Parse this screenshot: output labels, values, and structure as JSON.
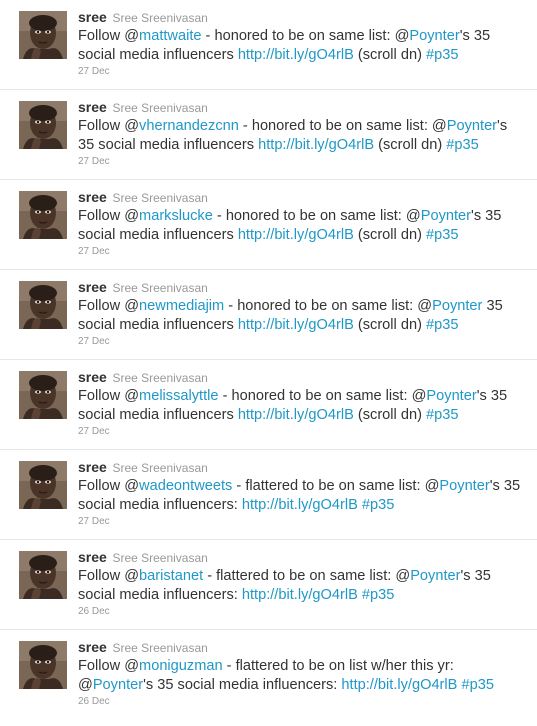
{
  "colors": {
    "link": "#1f98c7",
    "meta": "#999999",
    "text": "#333333"
  },
  "tweets": [
    {
      "handle": "sree",
      "name": "Sree Sreenivasan",
      "parts": [
        {
          "t": "text",
          "v": "Follow @"
        },
        {
          "t": "mention",
          "v": "mattwaite"
        },
        {
          "t": "text",
          "v": " - honored to be on same list: @"
        },
        {
          "t": "mention",
          "v": "Poynter"
        },
        {
          "t": "text",
          "v": "'s 35 social media influencers "
        },
        {
          "t": "link",
          "v": "http://bit.ly/gO4rlB"
        },
        {
          "t": "text",
          "v": " (scroll dn) "
        },
        {
          "t": "hashtag",
          "v": "#p35"
        }
      ],
      "date": "27 Dec"
    },
    {
      "handle": "sree",
      "name": "Sree Sreenivasan",
      "parts": [
        {
          "t": "text",
          "v": "Follow @"
        },
        {
          "t": "mention",
          "v": "vhernandezcnn"
        },
        {
          "t": "text",
          "v": " - honored to be on same list: @"
        },
        {
          "t": "mention",
          "v": "Poynter"
        },
        {
          "t": "text",
          "v": "'s 35 social media influencers "
        },
        {
          "t": "link",
          "v": "http://bit.ly/gO4rlB"
        },
        {
          "t": "text",
          "v": " (scroll dn) "
        },
        {
          "t": "hashtag",
          "v": "#p35"
        }
      ],
      "date": "27 Dec"
    },
    {
      "handle": "sree",
      "name": "Sree Sreenivasan",
      "parts": [
        {
          "t": "text",
          "v": "Follow @"
        },
        {
          "t": "mention",
          "v": "markslucke"
        },
        {
          "t": "text",
          "v": " - honored to be on same list: @"
        },
        {
          "t": "mention",
          "v": "Poynter"
        },
        {
          "t": "text",
          "v": "'s 35 social media influencers "
        },
        {
          "t": "link",
          "v": "http://bit.ly/gO4rlB"
        },
        {
          "t": "text",
          "v": " (scroll dn) "
        },
        {
          "t": "hashtag",
          "v": "#p35"
        }
      ],
      "date": "27 Dec"
    },
    {
      "handle": "sree",
      "name": "Sree Sreenivasan",
      "parts": [
        {
          "t": "text",
          "v": "Follow @"
        },
        {
          "t": "mention",
          "v": "newmediajim"
        },
        {
          "t": "text",
          "v": " - honored to be on same list: @"
        },
        {
          "t": "mention",
          "v": "Poynter"
        },
        {
          "t": "text",
          "v": " 35 social media influencers "
        },
        {
          "t": "link",
          "v": "http://bit.ly/gO4rlB"
        },
        {
          "t": "text",
          "v": " (scroll dn) "
        },
        {
          "t": "hashtag",
          "v": "#p35"
        }
      ],
      "date": "27 Dec"
    },
    {
      "handle": "sree",
      "name": "Sree Sreenivasan",
      "parts": [
        {
          "t": "text",
          "v": "Follow @"
        },
        {
          "t": "mention",
          "v": "melissalyttle"
        },
        {
          "t": "text",
          "v": " - honored to be on same list: @"
        },
        {
          "t": "mention",
          "v": "Poynter"
        },
        {
          "t": "text",
          "v": "'s 35 social media influencers "
        },
        {
          "t": "link",
          "v": "http://bit.ly/gO4rlB"
        },
        {
          "t": "text",
          "v": " (scroll dn) "
        },
        {
          "t": "hashtag",
          "v": "#p35"
        }
      ],
      "date": "27 Dec"
    },
    {
      "handle": "sree",
      "name": "Sree Sreenivasan",
      "parts": [
        {
          "t": "text",
          "v": "Follow @"
        },
        {
          "t": "mention",
          "v": "wadeontweets"
        },
        {
          "t": "text",
          "v": " - flattered to be on same list: @"
        },
        {
          "t": "mention",
          "v": "Poynter"
        },
        {
          "t": "text",
          "v": "'s 35 social media influencers: "
        },
        {
          "t": "link",
          "v": "http://bit.ly/gO4rlB"
        },
        {
          "t": "text",
          "v": " "
        },
        {
          "t": "hashtag",
          "v": "#p35"
        }
      ],
      "date": "27 Dec"
    },
    {
      "handle": "sree",
      "name": "Sree Sreenivasan",
      "parts": [
        {
          "t": "text",
          "v": "Follow @"
        },
        {
          "t": "mention",
          "v": "baristanet"
        },
        {
          "t": "text",
          "v": " - flattered to be on same list: @"
        },
        {
          "t": "mention",
          "v": "Poynter"
        },
        {
          "t": "text",
          "v": "'s 35 social media influencers: "
        },
        {
          "t": "link",
          "v": "http://bit.ly/gO4rlB"
        },
        {
          "t": "text",
          "v": " "
        },
        {
          "t": "hashtag",
          "v": "#p35"
        }
      ],
      "date": "26 Dec"
    },
    {
      "handle": "sree",
      "name": "Sree Sreenivasan",
      "parts": [
        {
          "t": "text",
          "v": "Follow @"
        },
        {
          "t": "mention",
          "v": "moniguzman"
        },
        {
          "t": "text",
          "v": " - flattered to be on list w/her this yr: @"
        },
        {
          "t": "mention",
          "v": "Poynter"
        },
        {
          "t": "text",
          "v": "'s 35 social media influencers: "
        },
        {
          "t": "link",
          "v": "http://bit.ly/gO4rlB"
        },
        {
          "t": "text",
          "v": " "
        },
        {
          "t": "hashtag",
          "v": "#p35"
        }
      ],
      "date": "26 Dec"
    }
  ]
}
